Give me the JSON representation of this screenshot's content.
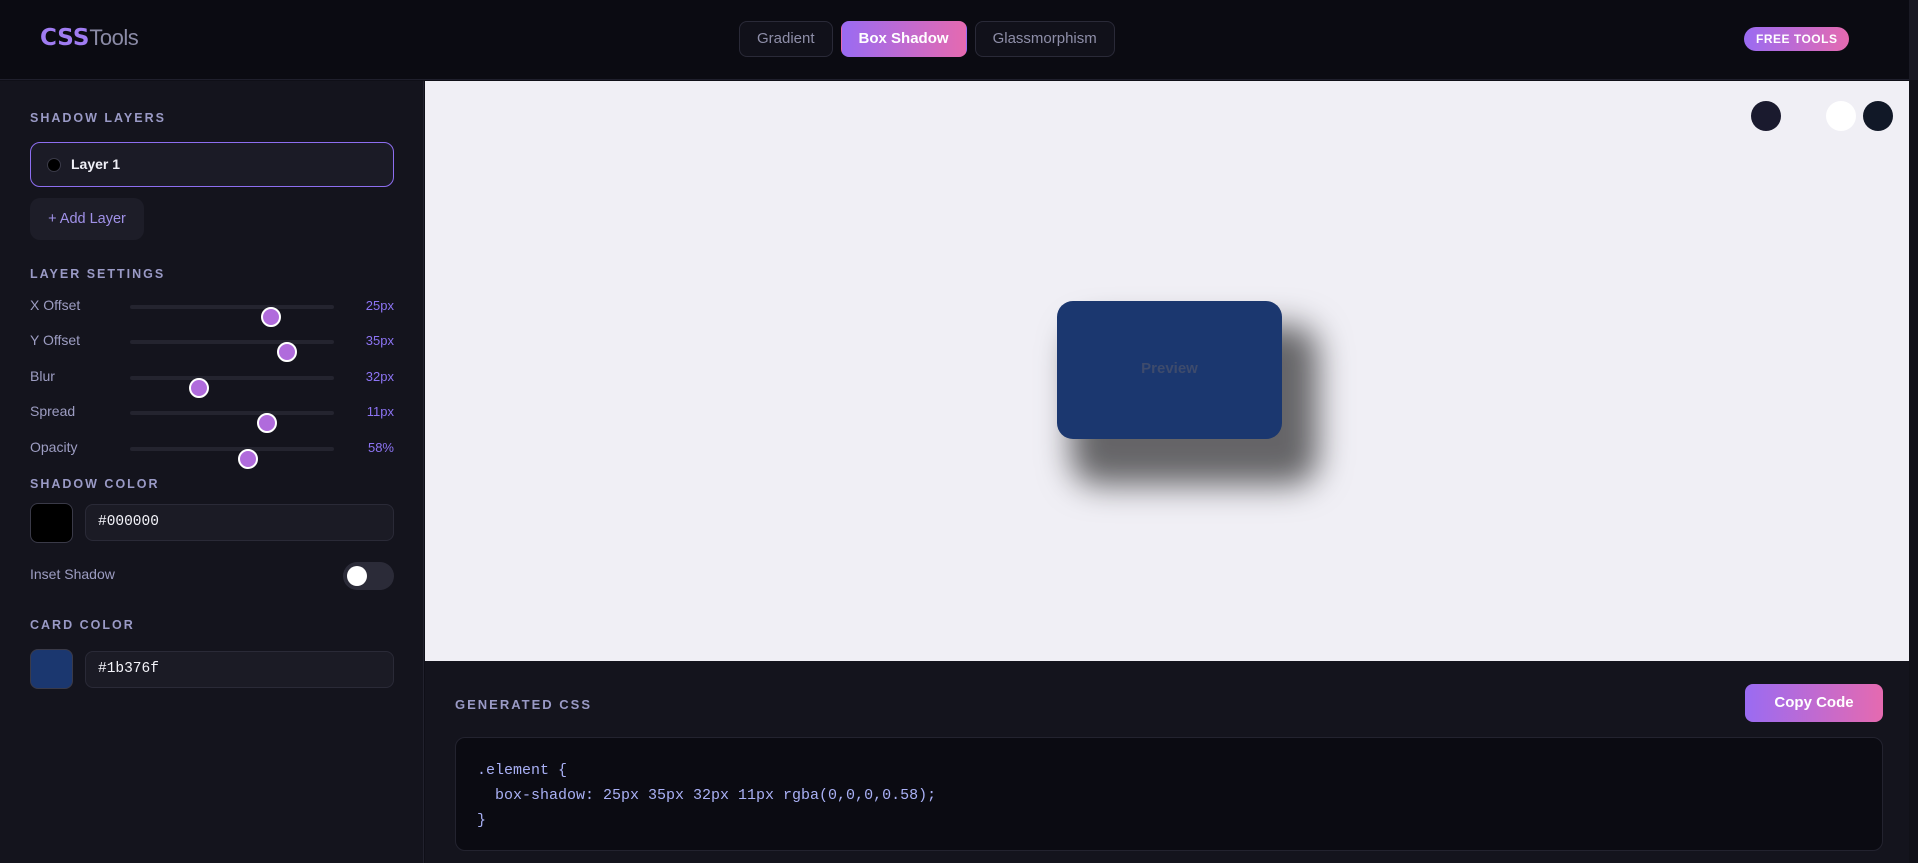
{
  "header": {
    "logo_primary": "CSS",
    "logo_secondary": "Tools",
    "tabs": [
      {
        "label": "Gradient",
        "active": false
      },
      {
        "label": "Box Shadow",
        "active": true
      },
      {
        "label": "Glassmorphism",
        "active": false
      }
    ],
    "badge": "FREE TOOLS"
  },
  "sidebar": {
    "shadow_layers_title": "SHADOW LAYERS",
    "layers": [
      {
        "label": "Layer 1",
        "color": "#000000"
      }
    ],
    "add_layer_label": "+ Add Layer",
    "layer_settings_title": "LAYER SETTINGS",
    "sliders": [
      {
        "label": "X Offset",
        "value": "25px",
        "level": 0.69
      },
      {
        "label": "Y Offset",
        "value": "35px",
        "level": 0.77
      },
      {
        "label": "Blur",
        "value": "32px",
        "level": 0.34
      },
      {
        "label": "Spread",
        "value": "11px",
        "level": 0.67
      },
      {
        "label": "Opacity",
        "value": "58%",
        "level": 0.58
      }
    ],
    "shadow_color_title": "SHADOW COLOR",
    "shadow_color": "#000000",
    "inset_label": "Inset Shadow",
    "inset_enabled": false,
    "card_color_title": "CARD COLOR",
    "card_color": "#1b376f"
  },
  "preview": {
    "card_text": "Preview",
    "background_options": [
      "#1a1a2e",
      "#f0eff5",
      "#ffffff",
      "#111827"
    ]
  },
  "code": {
    "title": "GENERATED CSS",
    "copy_label": "Copy Code",
    "snippet": ".element {\n  box-shadow: 25px 35px 32px 11px rgba(0,0,0,0.58);\n}"
  }
}
